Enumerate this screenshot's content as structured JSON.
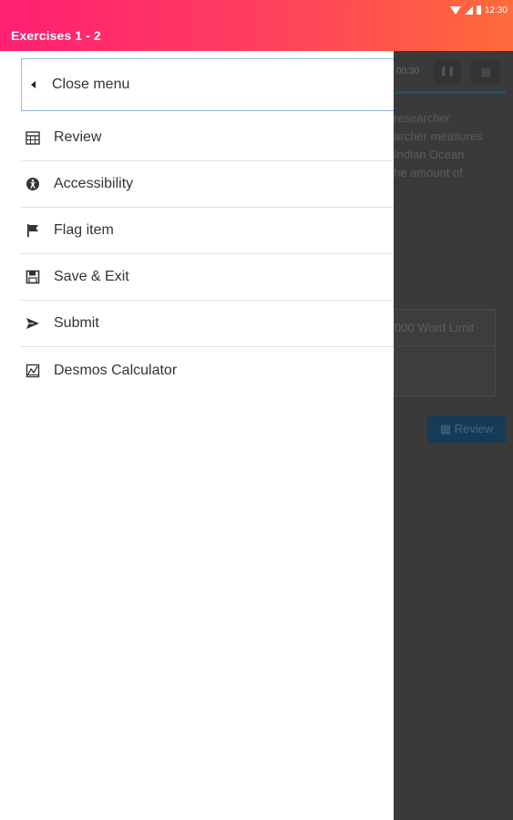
{
  "status_bar": {
    "time": "12:30",
    "icons": [
      "wifi-icon",
      "cell-signal-icon",
      "battery-icon"
    ]
  },
  "app_bar": {
    "title": "Exercises 1 - 2",
    "gradient": [
      "#ff1f73",
      "#ff6b3a"
    ]
  },
  "drawer": {
    "close_label": "Close menu",
    "items": [
      {
        "label": "Review",
        "icon": "calendar-grid-icon"
      },
      {
        "label": "Accessibility",
        "icon": "accessibility-icon"
      },
      {
        "label": "Flag item",
        "icon": "flag-icon"
      },
      {
        "label": "Save & Exit",
        "icon": "save-icon"
      },
      {
        "label": "Submit",
        "icon": "send-icon"
      },
      {
        "label": "Desmos Calculator",
        "icon": "graph-icon"
      }
    ]
  },
  "background": {
    "timer": "00:30",
    "question_lines": [
      "researcher",
      "archer measures",
      "Indian Ocean",
      "he amount of"
    ],
    "word_limit": "000 Word Limit",
    "review_button": "Review"
  }
}
